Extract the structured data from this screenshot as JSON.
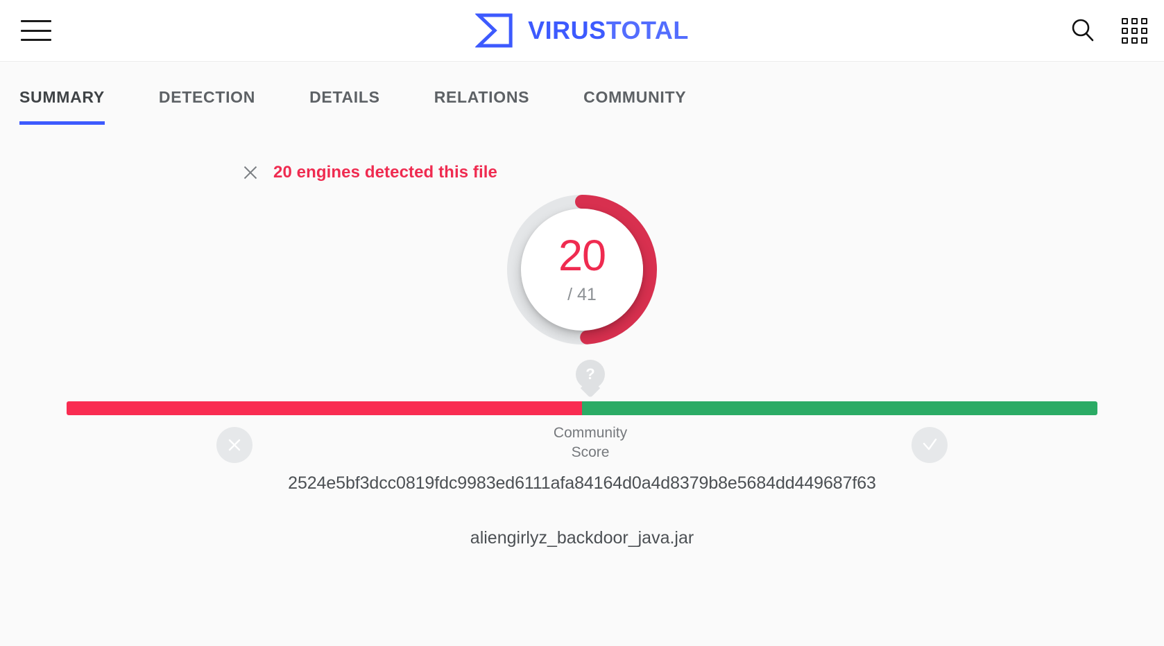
{
  "header": {
    "menu_icon": "hamburger-menu-icon",
    "brand_first": "VIRUS",
    "brand_second": "TOTAL",
    "brand_color": "#3d5afe",
    "search_icon": "search-icon",
    "apps_icon": "apps-grid-icon"
  },
  "tabs": [
    {
      "label": "SUMMARY",
      "active": true
    },
    {
      "label": "DETECTION",
      "active": false
    },
    {
      "label": "DETAILS",
      "active": false
    },
    {
      "label": "RELATIONS",
      "active": false
    },
    {
      "label": "COMMUNITY",
      "active": false
    }
  ],
  "banner": {
    "close_icon": "close-icon",
    "message": "20 engines detected this file",
    "color": "#ef2b50"
  },
  "gauge": {
    "detections": "20",
    "total": "/ 41",
    "detections_number": 20,
    "total_number": 41,
    "ratio_percent": 48.8,
    "arc_color": "#d8304f",
    "track_color": "#e4e6e8"
  },
  "community_score": {
    "marker_label": "?",
    "label_line1": "Community",
    "label_line2": "Score",
    "bad_percent": 50,
    "good_percent": 50,
    "bad_color": "#f92c51",
    "good_color": "#2bab65",
    "downvote_icon": "thumbs-down-x-icon",
    "upvote_icon": "thumbs-up-check-icon"
  },
  "file": {
    "hash": "2524e5bf3dcc0819fdc9983ed6111afa84164d0a4d8379b8e5684dd449687f63",
    "filename": "aliengirlyz_backdoor_java.jar"
  }
}
